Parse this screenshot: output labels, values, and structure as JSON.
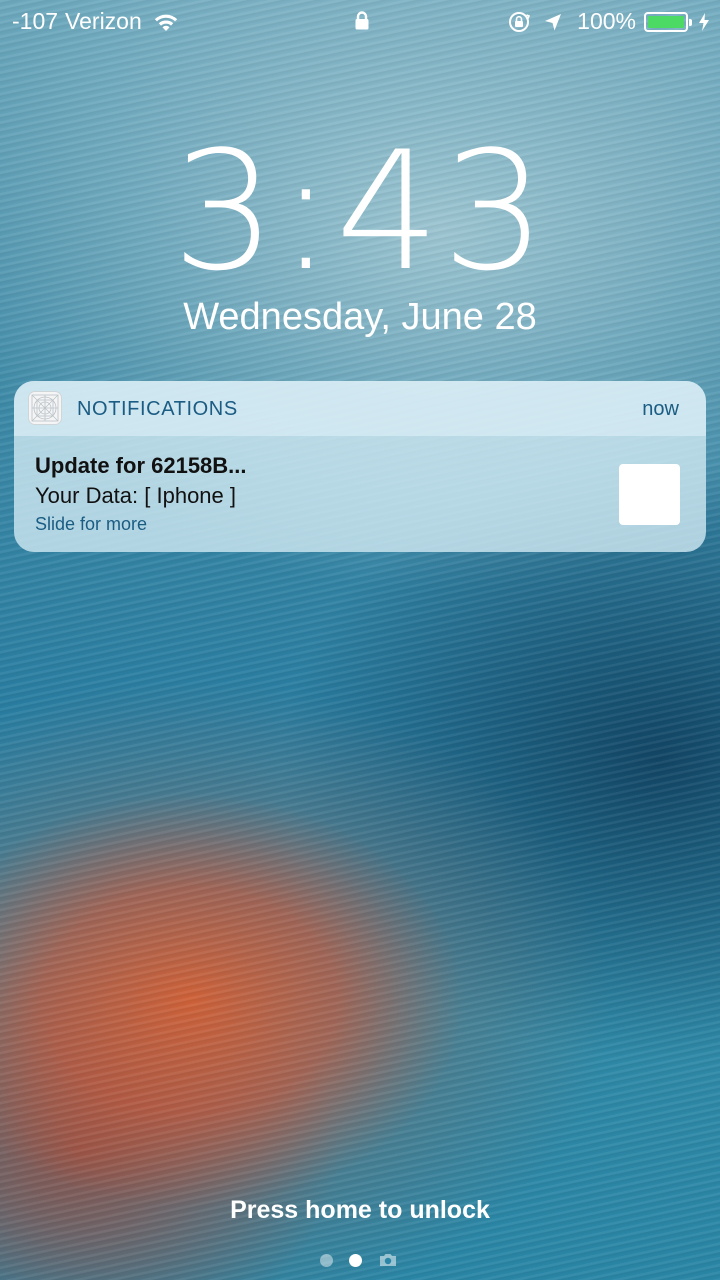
{
  "status_bar": {
    "signal": "-107",
    "carrier": "Verizon",
    "battery_percent": "100%",
    "battery_level": 1.0,
    "battery_color": "#4cd964",
    "icons": [
      "wifi-icon",
      "lock-icon",
      "orientation-lock-icon",
      "location-arrow-icon",
      "battery-icon",
      "charging-bolt-icon"
    ]
  },
  "lock_screen": {
    "time": "3:43",
    "date": "Wednesday, June 28",
    "unlock_hint": "Press home to unlock"
  },
  "notification": {
    "app_name": "NOTIFICATIONS",
    "time": "now",
    "title": "Update for 62158B...",
    "message": "Your Data: [ Iphone ]",
    "action": "Slide for more",
    "accent_color": "#1b5c83"
  },
  "page_indicator": {
    "pages": 3,
    "active_index": 1,
    "last_icon": "camera-icon"
  }
}
